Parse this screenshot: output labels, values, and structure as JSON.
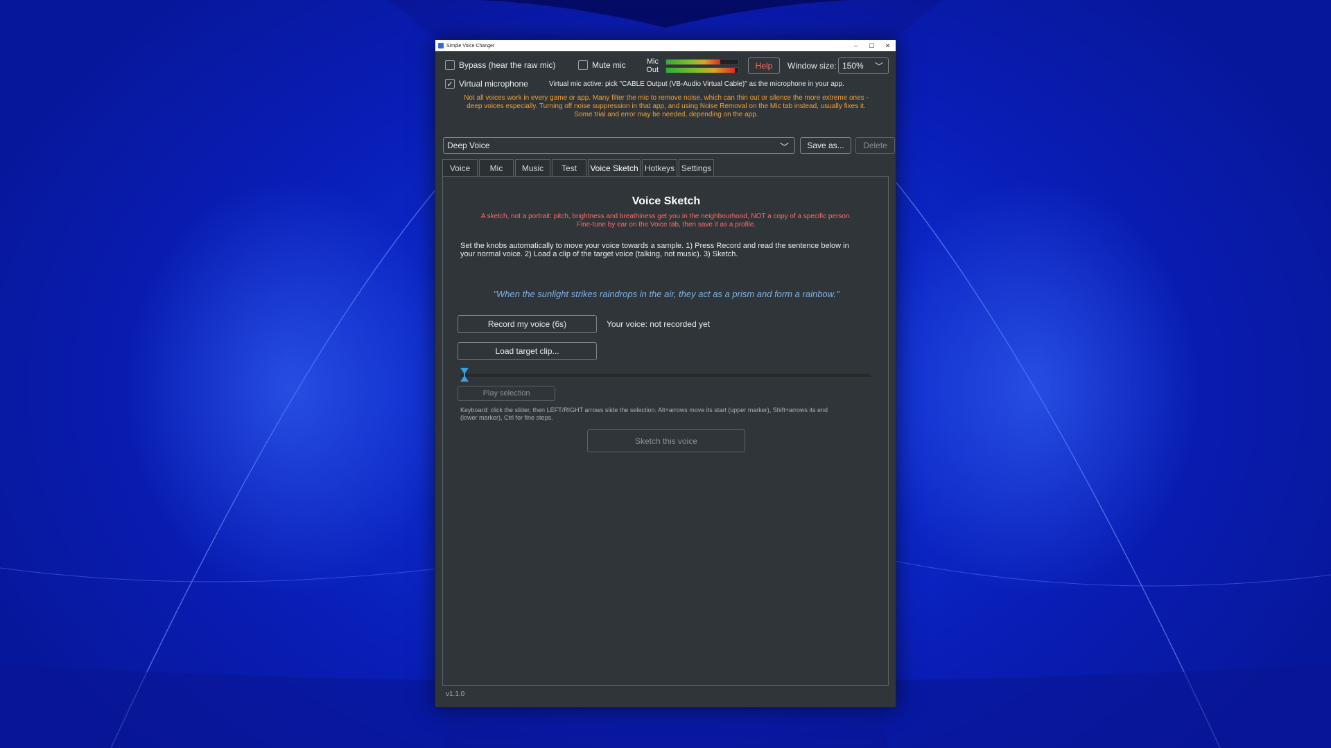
{
  "window": {
    "title": "Simple Voice Changer",
    "controls": {
      "minimize": "–",
      "maximize": "☐",
      "close": "✕"
    }
  },
  "top_bar": {
    "bypass_label": "Bypass (hear the raw mic)",
    "bypass_checked": false,
    "mute_label": "Mute mic",
    "mute_checked": false,
    "meters": [
      {
        "label": "Mic",
        "level": 0.75
      },
      {
        "label": "Out",
        "level": 0.95
      }
    ],
    "help_label": "Help",
    "window_size_label": "Window size:",
    "window_size_value": "150%",
    "virtual_mic_label": "Virtual microphone",
    "virtual_mic_checked": true,
    "virtual_mic_status": "Virtual mic active: pick \"CABLE Output (VB-Audio Virtual Cable)\" as the microphone in your app.",
    "check_glyph": "✓"
  },
  "notice": {
    "line1": "Not all voices work in every game or app. Many filter the mic to remove noise, which can thin out or silence the more extreme ones -",
    "line2": "deep voices especially. Turning off noise suppression in that app, and using Noise Removal on the Mic tab instead, usually fixes it.",
    "line3": "Some trial and error may be needed, depending on the app."
  },
  "profile": {
    "selected": "Deep Voice",
    "save_as_label": "Save as...",
    "delete_label": "Delete"
  },
  "tabs": [
    {
      "label": "Voice",
      "active": false
    },
    {
      "label": "Mic",
      "active": false
    },
    {
      "label": "Music",
      "active": false
    },
    {
      "label": "Test",
      "active": false
    },
    {
      "label": "Voice Sketch",
      "active": true
    },
    {
      "label": "Hotkeys",
      "active": false
    },
    {
      "label": "Settings",
      "active": false
    }
  ],
  "voice_sketch": {
    "title": "Voice Sketch",
    "warning_line1": "A sketch, not a portrait: pitch, brightness and breathiness get you in the neighbourhood, NOT a copy of a specific person.",
    "warning_line2": "Fine-tune by ear on the Voice tab, then save it as a profile.",
    "instructions_line1": "Set the knobs automatically to move your voice towards a sample.  1) Press Record and read the sentence below in",
    "instructions_line2": "your normal voice.  2) Load a clip of the target voice (talking, not music).  3) Sketch.",
    "sentence": "\"When the sunlight strikes raindrops in the air, they act as a prism and form a rainbow.\"",
    "record_button": "Record my voice (6s)",
    "voice_status": "Your voice: not recorded yet",
    "load_button": "Load target clip...",
    "selection_start": 0,
    "selection_end": 0,
    "play_button": "Play selection",
    "keyboard_hint_line1": "Keyboard: click the slider, then LEFT/RIGHT arrows slide the selection. Alt+arrows move its start (upper marker), Shift+arrows its end",
    "keyboard_hint_line2": "(lower marker), Ctrl for fine steps.",
    "sketch_button": "Sketch this voice"
  },
  "footer": {
    "version": "v1.1.0"
  },
  "colors": {
    "accent_warning": "#ff6b6b",
    "notice": "#f0a23a",
    "sentence": "#7fb3e6",
    "marker": "#3aa0e0"
  }
}
